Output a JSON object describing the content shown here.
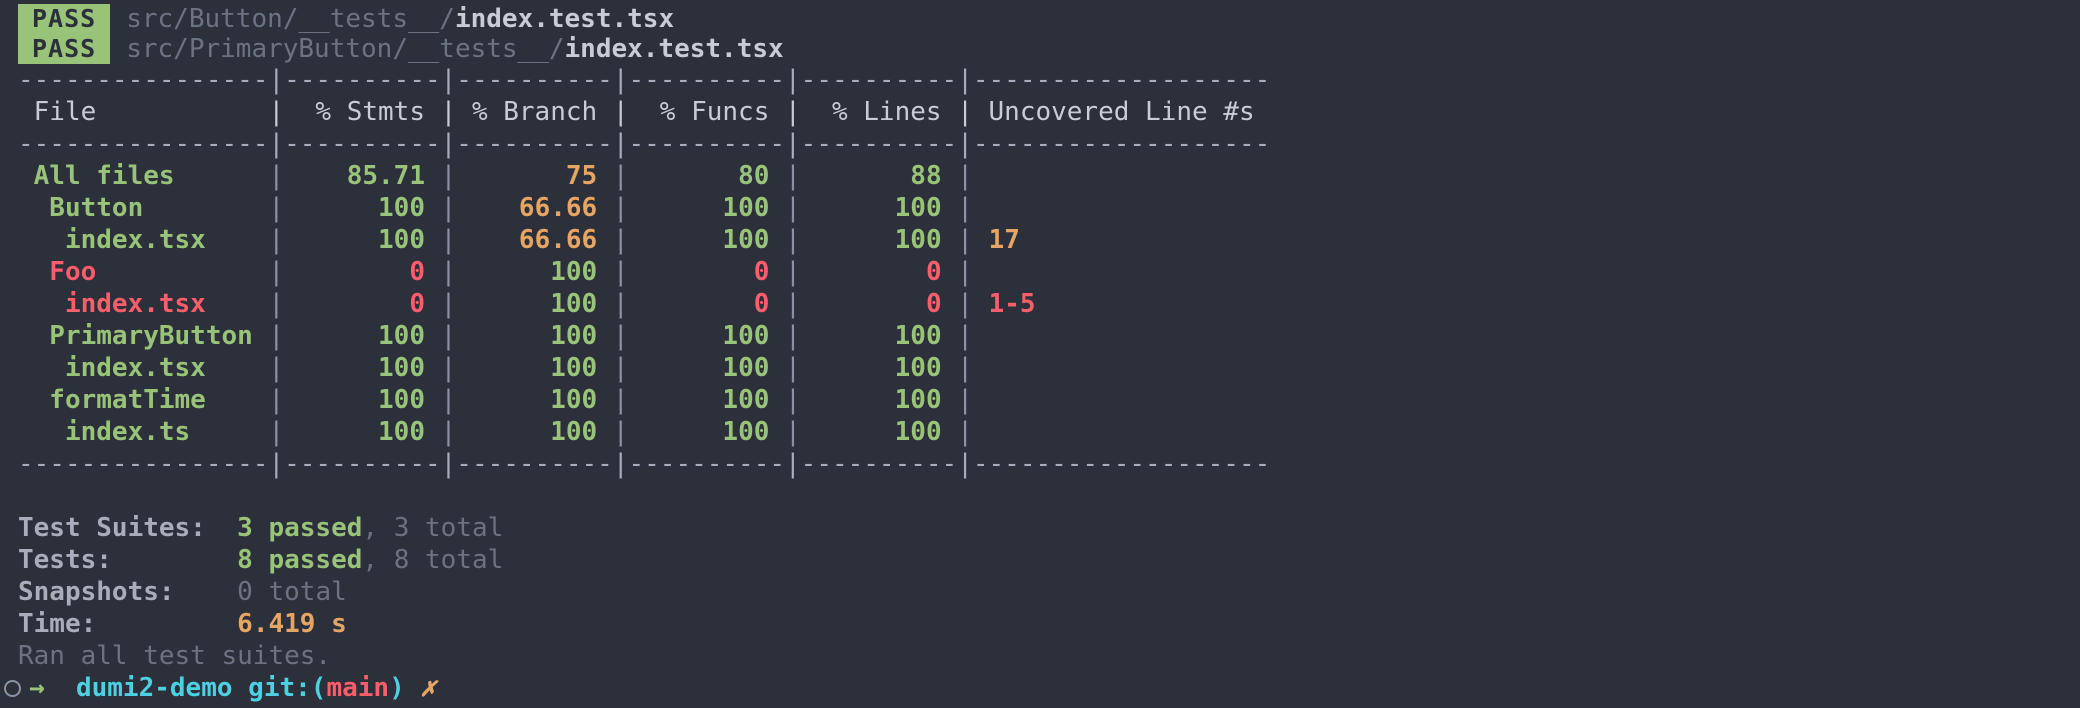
{
  "terminal": {
    "background": "#2b303b",
    "colors": {
      "green": "#98c379",
      "orange": "#e5a564",
      "red": "#fc5d6b",
      "dim": "#6b7280",
      "plain": "#a7adba",
      "cyan": "#4dd0e1"
    }
  },
  "pass_lines": [
    {
      "badge": "PASS",
      "dir": "src/Button/__tests__/",
      "file": "index.test.tsx"
    },
    {
      "badge": "PASS",
      "dir": "src/PrimaryButton/__tests__/",
      "file": "index.test.tsx"
    }
  ],
  "table": {
    "rule": "----------------|----------|----------|----------|----------|-------------------",
    "headers": [
      "File",
      "% Stmts",
      "% Branch",
      "% Funcs",
      "% Lines",
      "Uncovered Line #s"
    ],
    "rows": [
      {
        "file": "All files",
        "indent": 0,
        "file_color": "green",
        "stmts": "85.71",
        "stmts_color": "green",
        "branch": "75",
        "branch_color": "orange",
        "funcs": "80",
        "funcs_color": "green",
        "lines": "88",
        "lines_color": "green",
        "uncovered": "",
        "uncovered_color": "orange"
      },
      {
        "file": "Button",
        "indent": 1,
        "file_color": "green",
        "stmts": "100",
        "stmts_color": "green",
        "branch": "66.66",
        "branch_color": "orange",
        "funcs": "100",
        "funcs_color": "green",
        "lines": "100",
        "lines_color": "green",
        "uncovered": "",
        "uncovered_color": "orange"
      },
      {
        "file": "index.tsx",
        "indent": 2,
        "file_color": "green",
        "stmts": "100",
        "stmts_color": "green",
        "branch": "66.66",
        "branch_color": "orange",
        "funcs": "100",
        "funcs_color": "green",
        "lines": "100",
        "lines_color": "green",
        "uncovered": "17",
        "uncovered_color": "orange"
      },
      {
        "file": "Foo",
        "indent": 1,
        "file_color": "red",
        "stmts": "0",
        "stmts_color": "red",
        "branch": "100",
        "branch_color": "green",
        "funcs": "0",
        "funcs_color": "red",
        "lines": "0",
        "lines_color": "red",
        "uncovered": "",
        "uncovered_color": "red"
      },
      {
        "file": "index.tsx",
        "indent": 2,
        "file_color": "red",
        "stmts": "0",
        "stmts_color": "red",
        "branch": "100",
        "branch_color": "green",
        "funcs": "0",
        "funcs_color": "red",
        "lines": "0",
        "lines_color": "red",
        "uncovered": "1-5",
        "uncovered_color": "red"
      },
      {
        "file": "PrimaryButton",
        "indent": 1,
        "file_color": "green",
        "stmts": "100",
        "stmts_color": "green",
        "branch": "100",
        "branch_color": "green",
        "funcs": "100",
        "funcs_color": "green",
        "lines": "100",
        "lines_color": "green",
        "uncovered": "",
        "uncovered_color": "green"
      },
      {
        "file": "index.tsx",
        "indent": 2,
        "file_color": "green",
        "stmts": "100",
        "stmts_color": "green",
        "branch": "100",
        "branch_color": "green",
        "funcs": "100",
        "funcs_color": "green",
        "lines": "100",
        "lines_color": "green",
        "uncovered": "",
        "uncovered_color": "green"
      },
      {
        "file": "formatTime",
        "indent": 1,
        "file_color": "green",
        "stmts": "100",
        "stmts_color": "green",
        "branch": "100",
        "branch_color": "green",
        "funcs": "100",
        "funcs_color": "green",
        "lines": "100",
        "lines_color": "green",
        "uncovered": "",
        "uncovered_color": "green"
      },
      {
        "file": "index.ts",
        "indent": 2,
        "file_color": "green",
        "stmts": "100",
        "stmts_color": "green",
        "branch": "100",
        "branch_color": "green",
        "funcs": "100",
        "funcs_color": "green",
        "lines": "100",
        "lines_color": "green",
        "uncovered": "",
        "uncovered_color": "green"
      }
    ]
  },
  "summary": {
    "test_suites": {
      "label": "Test Suites:",
      "passed": "3 passed",
      "total": ", 3 total"
    },
    "tests": {
      "label": "Tests:",
      "passed": "8 passed",
      "total": ", 8 total"
    },
    "snapshots": {
      "label": "Snapshots:",
      "total": "0 total"
    },
    "time": {
      "label": "Time:",
      "value": "6.419 s"
    },
    "ran_all": "Ran all test suites."
  },
  "prompt": {
    "arrow": "→",
    "cwd": "dumi2-demo",
    "git_prefix": "git:(",
    "branch": "main",
    "git_suffix": ")",
    "status": "✗"
  }
}
